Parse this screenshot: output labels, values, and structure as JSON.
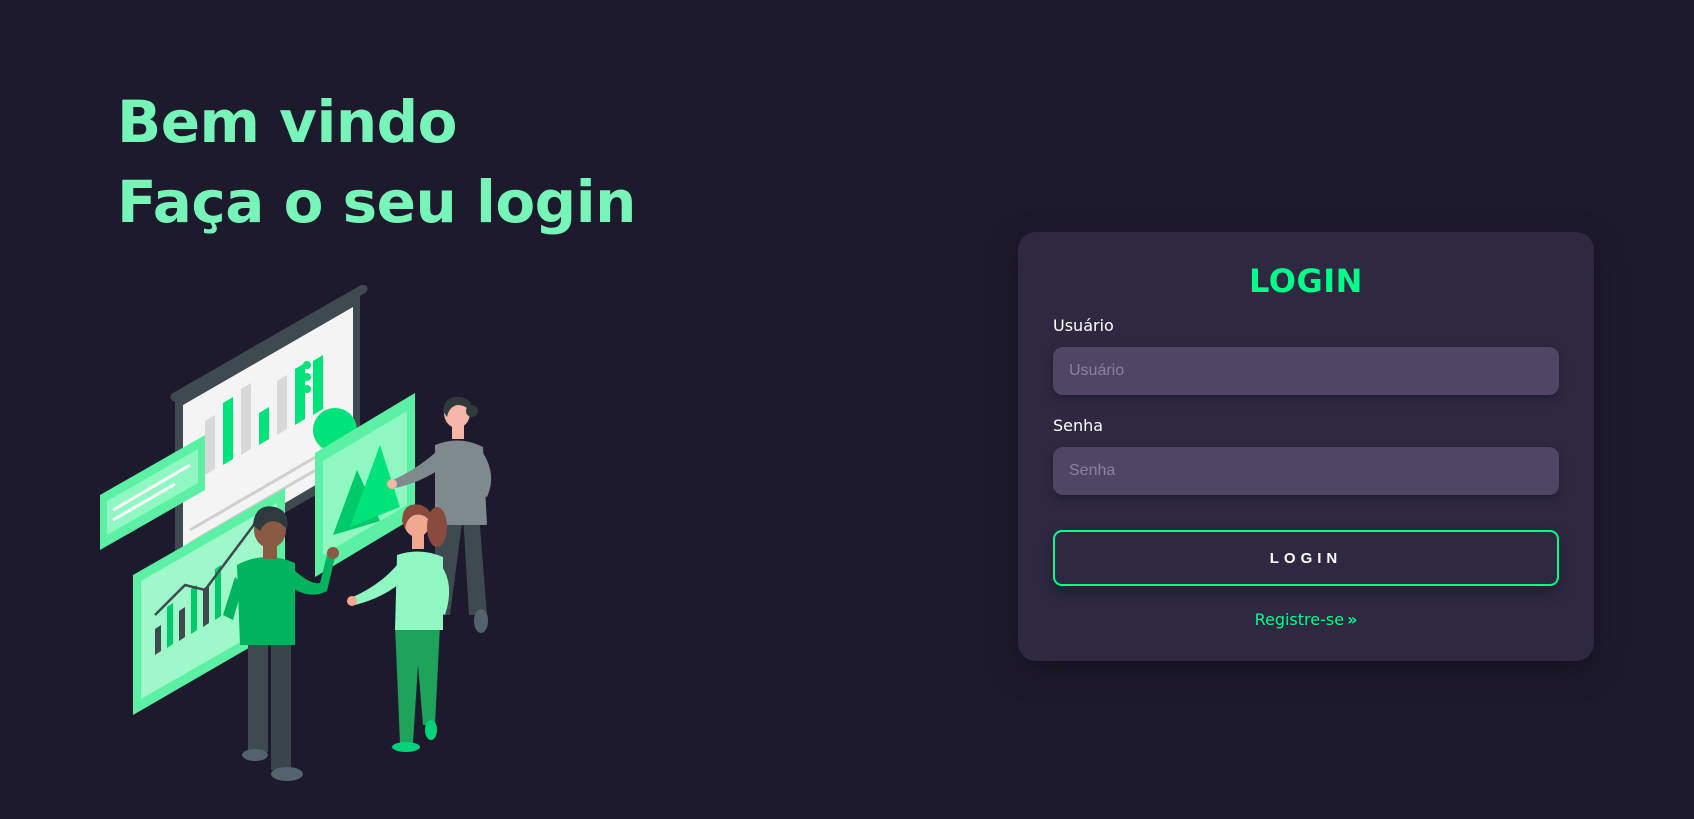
{
  "welcome": {
    "line1": "Bem vindo",
    "line2": "Faça o seu login"
  },
  "illustration": {
    "icon": "team-dashboard-illustration"
  },
  "login_card": {
    "title": "LOGIN",
    "username_label": "Usuário",
    "username_placeholder": "Usuário",
    "password_label": "Senha",
    "password_placeholder": "Senha",
    "submit_label": "LOGIN",
    "register_label": "Registre-se",
    "register_icon": "double-chevron-right-icon"
  },
  "colors": {
    "background": "#1e1a2d",
    "card": "#2e2941",
    "input": "#4f4664",
    "accent": "#00ff88",
    "heading": "#77f5b8"
  }
}
